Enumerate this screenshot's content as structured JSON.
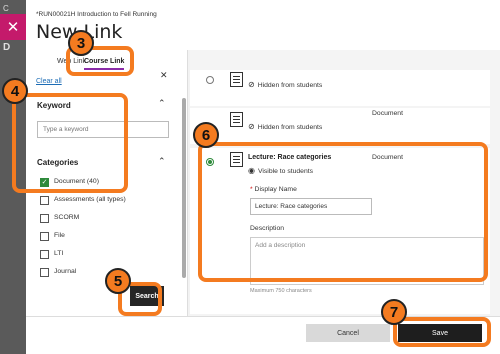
{
  "background": {
    "strip_text_1": "C",
    "strip_text_2": "D"
  },
  "modal": {
    "course_name": "*RUN00021H Introduction to Fell Running",
    "title": "New Link"
  },
  "tabs": [
    {
      "label": "Web Link"
    },
    {
      "label": "Course Link"
    }
  ],
  "filters": {
    "clear_all": "Clear all",
    "keyword_label": "Keyword",
    "keyword_placeholder": "Type a keyword",
    "categories_label": "Categories",
    "categories": [
      {
        "label": "Document (40)",
        "checked": true
      },
      {
        "label": "Assessments (all types)",
        "checked": false
      },
      {
        "label": "SCORM",
        "checked": false
      },
      {
        "label": "File",
        "checked": false
      },
      {
        "label": "LTI",
        "checked": false
      },
      {
        "label": "Journal",
        "checked": false
      }
    ],
    "search_label": "Search"
  },
  "items": [
    {
      "visibility": "Hidden from students",
      "type": ""
    },
    {
      "visibility": "Hidden from students",
      "type": "Document"
    },
    {
      "name": "Lecture: Race categories",
      "visibility": "Visible to students",
      "type": "Document"
    }
  ],
  "form": {
    "display_name_label": "Display Name",
    "display_name_value": "Lecture: Race categories",
    "description_label": "Description",
    "description_placeholder": "Add a description",
    "max_chars": "Maximum 750 characters"
  },
  "footer": {
    "cancel_label": "Cancel",
    "save_label": "Save"
  },
  "annotations": [
    "3",
    "4",
    "5",
    "6",
    "7"
  ],
  "colors": {
    "accent": "#f47b20",
    "close": "#c41a6b",
    "checked": "#2e8a3b",
    "tab_underline": "#8a2aa8"
  }
}
